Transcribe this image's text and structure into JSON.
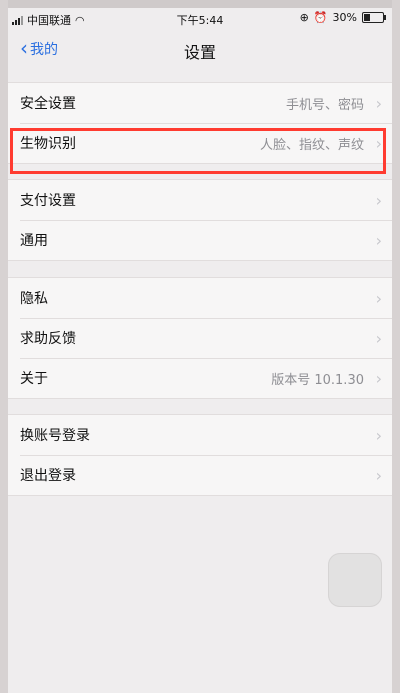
{
  "status_bar": {
    "carrier": "中国联通",
    "time": "下午5:44",
    "battery": "30%",
    "battery_level": 0.3
  },
  "nav": {
    "back_label": "我的",
    "title": "设置"
  },
  "groups": [
    {
      "rows": [
        {
          "label": "安全设置",
          "detail": "手机号、密码"
        },
        {
          "label": "生物识别",
          "detail": "人脸、指纹、声纹"
        }
      ]
    },
    {
      "rows": [
        {
          "label": "支付设置",
          "detail": ""
        },
        {
          "label": "通用",
          "detail": ""
        }
      ]
    },
    {
      "rows": [
        {
          "label": "隐私",
          "detail": ""
        },
        {
          "label": "求助反馈",
          "detail": ""
        },
        {
          "label": "关于",
          "detail": "版本号 10.1.30"
        }
      ]
    },
    {
      "rows": [
        {
          "label": "换账号登录",
          "detail": ""
        },
        {
          "label": "退出登录",
          "detail": ""
        }
      ]
    }
  ],
  "annotation": {
    "highlight_color": "#ff3b30",
    "highlighted_row": "生物识别"
  },
  "icons": {
    "back": "chevron-left-icon",
    "row_arrow": "chevron-right-icon",
    "wifi": "wifi-icon",
    "alarm": "alarm-icon"
  }
}
